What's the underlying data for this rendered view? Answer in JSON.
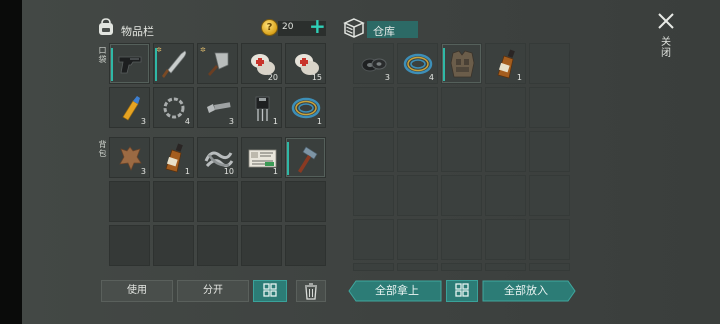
{
  "inventory": {
    "title": "物品栏",
    "coins": "20",
    "add_label": "+",
    "hotbar_label": "口袋",
    "backpack_label": "背包",
    "hotbar": [
      {
        "icon": "pistol-icon",
        "qty": ""
      },
      {
        "icon": "machete-icon",
        "qty": ""
      },
      {
        "icon": "cleaver-icon",
        "qty": ""
      },
      {
        "icon": "bandage-icon",
        "qty": "20"
      },
      {
        "icon": "bandage-icon",
        "qty": "15"
      }
    ],
    "row2": [
      {
        "icon": "glue-icon",
        "qty": "3"
      },
      {
        "icon": "chain-icon",
        "qty": "4"
      },
      {
        "icon": "bolt-nut-icon",
        "qty": "3"
      },
      {
        "icon": "electronics-icon",
        "qty": "1"
      },
      {
        "icon": "wire-coil-icon",
        "qty": "1"
      }
    ],
    "backpack": [
      {
        "icon": "leather-icon",
        "qty": "3"
      },
      {
        "icon": "whiskey-bottle-icon",
        "qty": "1"
      },
      {
        "icon": "rope-icon",
        "qty": "10"
      },
      {
        "icon": "card-icon",
        "qty": "1"
      },
      {
        "icon": "hammer-icon",
        "qty": ""
      }
    ]
  },
  "storage": {
    "title": "仓库",
    "items": [
      {
        "icon": "tire-icon",
        "qty": "3"
      },
      {
        "icon": "wire-coil-icon",
        "qty": "4"
      },
      {
        "icon": "armor-icon",
        "qty": ""
      },
      {
        "icon": "whiskey-bottle-icon",
        "qty": "1"
      }
    ]
  },
  "close_label": "关闭",
  "buttons": {
    "use": "使用",
    "split": "分开",
    "take_all": "全部拿上",
    "put_all": "全部放入"
  },
  "colors": {
    "accent": "#2fd0b8",
    "panel": "#353937",
    "teal_button": "#2c7c76"
  }
}
